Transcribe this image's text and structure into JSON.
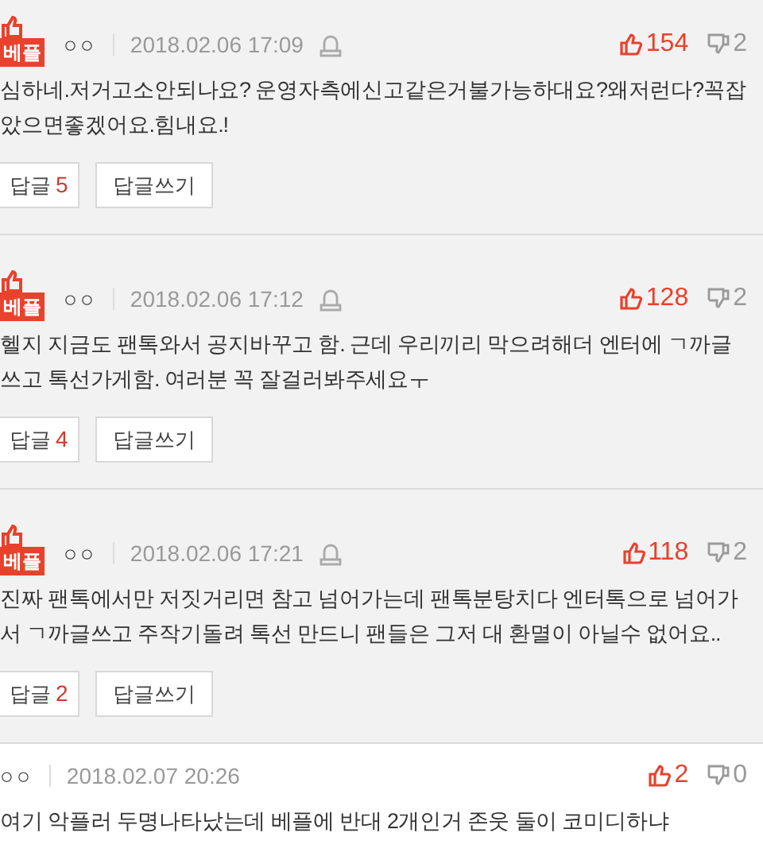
{
  "comments": [
    {
      "best": true,
      "badge": "베플",
      "author": "○○",
      "date": "2018.02.06 17:09",
      "report_icon": true,
      "likes": "154",
      "dislikes": "2",
      "body": "심하네.저거고소안되나요? 운영자측에신고같은거불가능하대요?왜저런다?꼭잡았으면좋겠어요.힘내요.!",
      "reply_label": "답글",
      "reply_count": "5",
      "write_reply": "답글쓰기"
    },
    {
      "best": true,
      "badge": "베플",
      "author": "○○",
      "date": "2018.02.06 17:12",
      "report_icon": true,
      "likes": "128",
      "dislikes": "2",
      "body": "헬지 지금도 팬톡와서 공지바꾸고 함. 근데 우리끼리 막으려해더 엔터에 ㄱ까글쓰고 톡선가게함. 여러분 꼭 잘걸러봐주세요ㅜ",
      "reply_label": "답글",
      "reply_count": "4",
      "write_reply": "답글쓰기"
    },
    {
      "best": true,
      "badge": "베플",
      "author": "○○",
      "date": "2018.02.06 17:21",
      "report_icon": true,
      "likes": "118",
      "dislikes": "2",
      "body": "진짜 팬톡에서만 저짓거리면 참고 넘어가는데 팬톡분탕치다 엔터톡으로 넘어가서 ㄱ까글쓰고 주작기돌려 톡선 만드니 팬들은 그저 대 환멸이 아닐수 없어요..",
      "reply_label": "답글",
      "reply_count": "2",
      "write_reply": "답글쓰기"
    },
    {
      "best": false,
      "author": "○○",
      "date": "2018.02.07 20:26",
      "report_icon": false,
      "likes": "2",
      "dislikes": "0",
      "body": "여기 악플러 두명나타났는데 베플에 반대 2개인거 존웃 둘이 코미디하냐"
    }
  ]
}
